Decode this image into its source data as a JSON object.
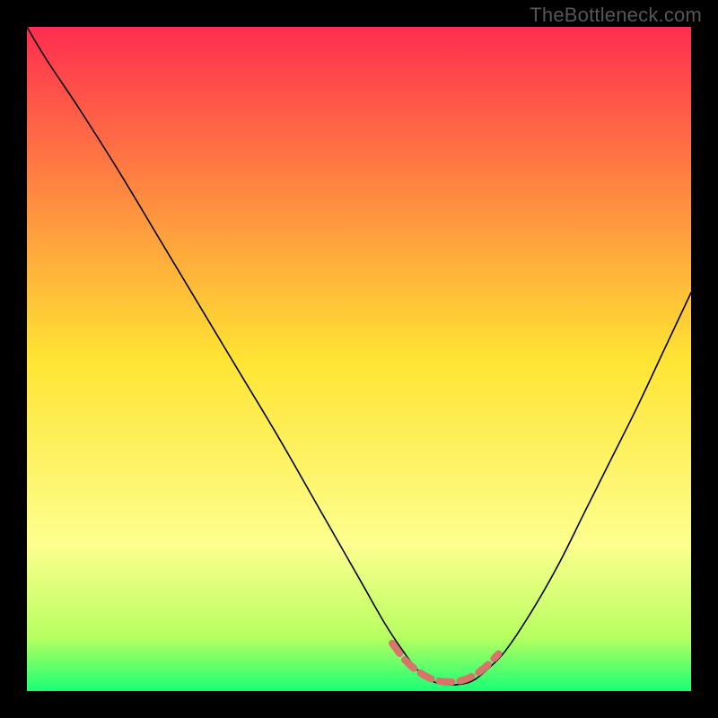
{
  "watermark": "TheBottleneck.com",
  "chart_data": {
    "type": "line",
    "title": "",
    "xlabel": "",
    "ylabel": "",
    "xlim": [
      0,
      100
    ],
    "ylim": [
      0,
      100
    ],
    "background_gradient": {
      "stops": [
        {
          "offset": 0.0,
          "color": "#ff2d4f"
        },
        {
          "offset": 0.5,
          "color": "#ffe433"
        },
        {
          "offset": 0.78,
          "color": "#fdff8f"
        },
        {
          "offset": 0.92,
          "color": "#b6ff60"
        },
        {
          "offset": 1.0,
          "color": "#19ff76"
        }
      ]
    },
    "series": [
      {
        "name": "curve",
        "color": "#000000",
        "stroke_width": 1.6,
        "x": [
          0,
          3,
          8,
          14,
          20,
          26,
          32,
          38,
          44,
          50,
          54,
          57,
          59,
          61,
          63,
          65,
          67,
          69,
          72,
          76,
          80,
          84,
          88,
          92,
          96,
          100
        ],
        "y": [
          100,
          95,
          87.5,
          78,
          68,
          58,
          48,
          38,
          27.5,
          17,
          10,
          5.5,
          3,
          1.5,
          1,
          1,
          1.5,
          3,
          6,
          12,
          19,
          27,
          35,
          43,
          51.5,
          60
        ]
      },
      {
        "name": "highlight",
        "color": "#d8756b",
        "stroke_width": 8,
        "linecap": "round",
        "dash": "14 9",
        "x": [
          55,
          57,
          59,
          61,
          63,
          65,
          67,
          69,
          71
        ],
        "y": [
          7.2,
          4.6,
          2.9,
          1.8,
          1.4,
          1.5,
          2.2,
          3.6,
          5.6
        ]
      }
    ]
  }
}
